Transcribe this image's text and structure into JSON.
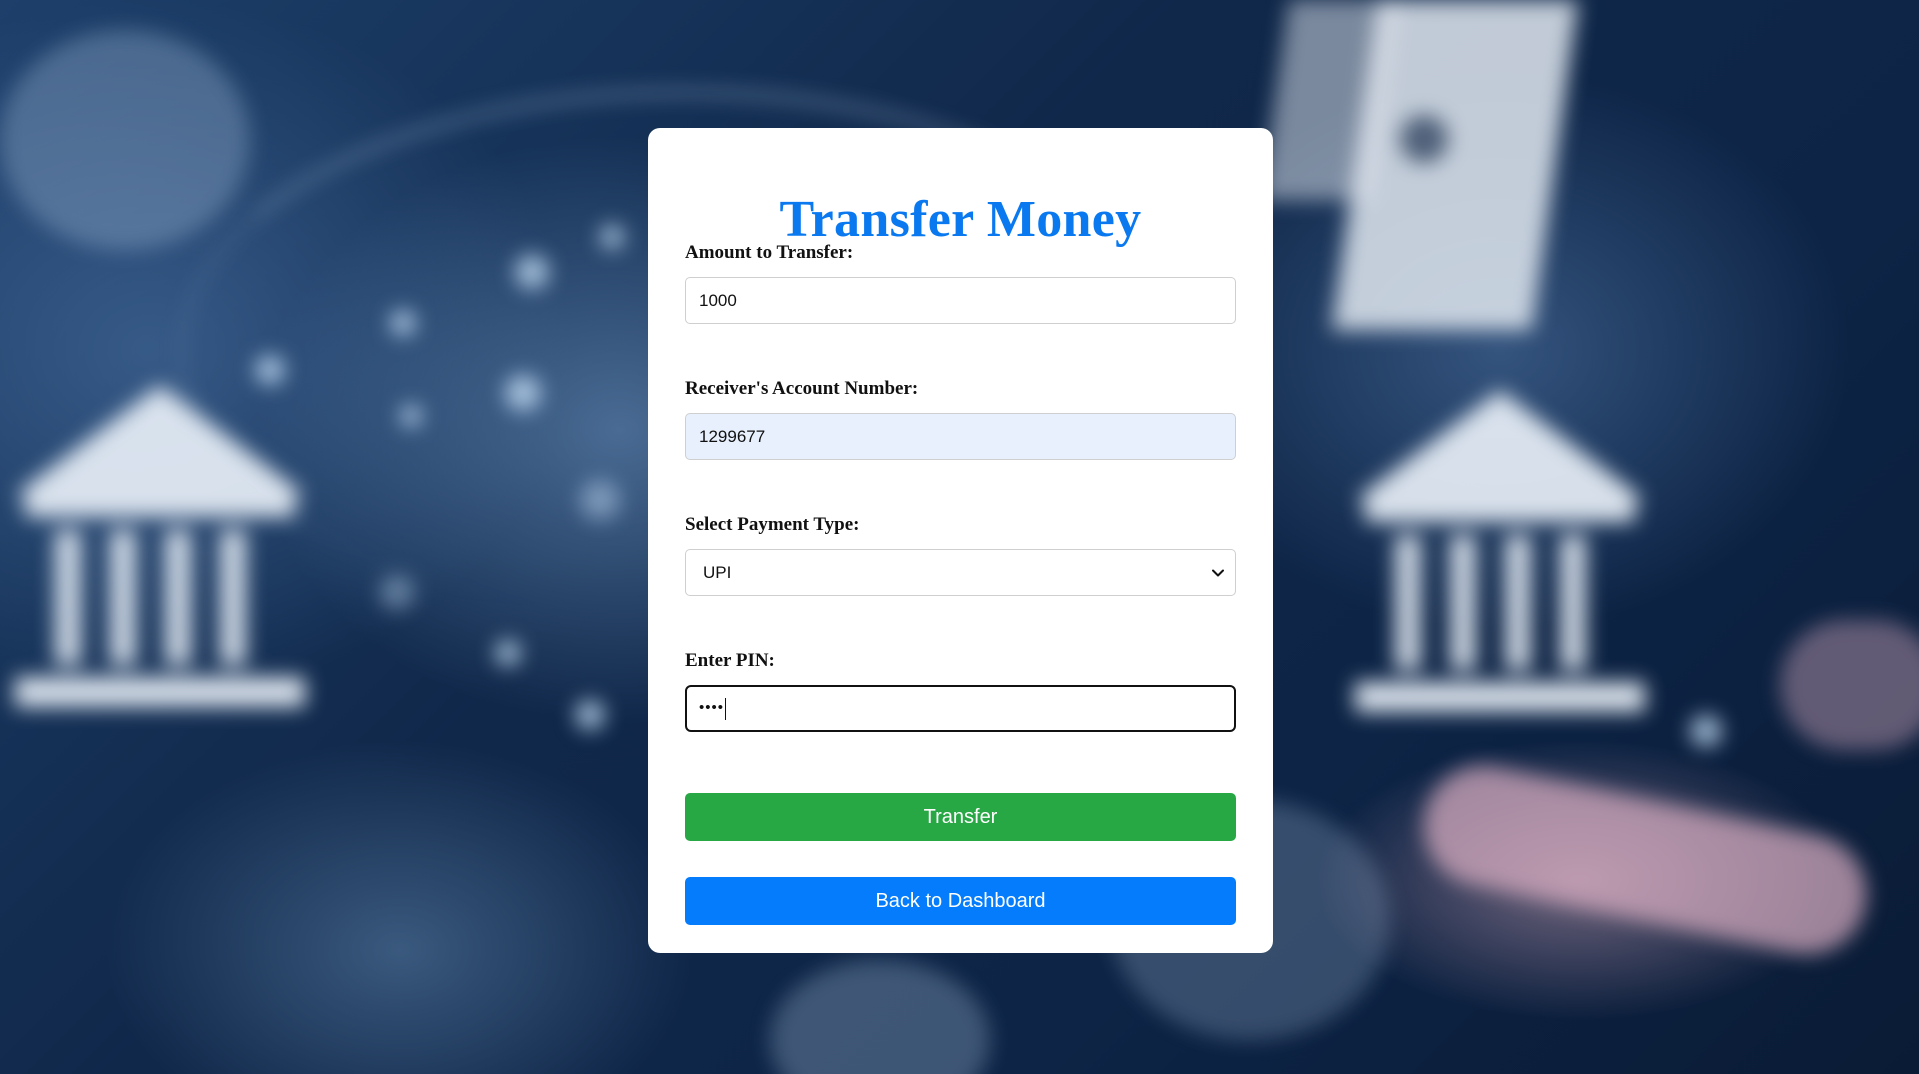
{
  "page": {
    "title": "Transfer Money"
  },
  "form": {
    "amount": {
      "label": "Amount to Transfer:",
      "value": "1000"
    },
    "account": {
      "label": "Receiver's Account Number:",
      "value": "1299677"
    },
    "payment_type": {
      "label": "Select Payment Type:",
      "selected": "UPI"
    },
    "pin": {
      "label": "Enter PIN:",
      "masked_value": "••••"
    }
  },
  "buttons": {
    "transfer_label": "Transfer",
    "back_label": "Back to Dashboard"
  },
  "colors": {
    "title": "#0a79f0",
    "transfer_button": "#28a745",
    "back_button": "#047cfc",
    "autofill_field": "#e8f0fe"
  },
  "icons": {
    "select_arrow": "chevron-down-icon"
  }
}
